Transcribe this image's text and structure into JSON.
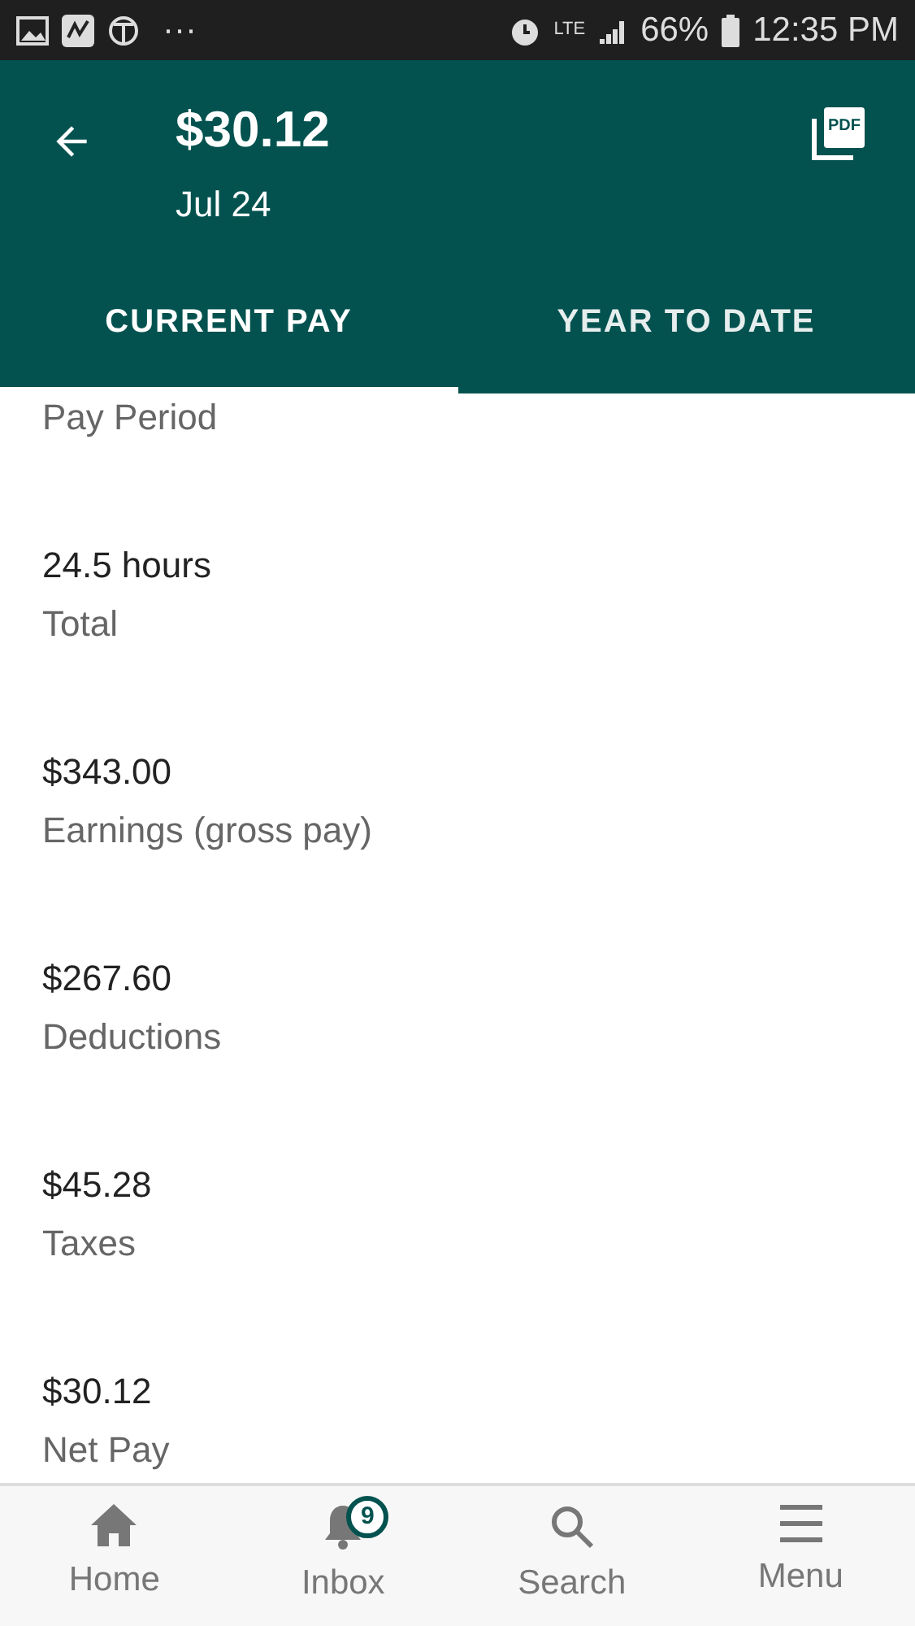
{
  "status_bar": {
    "more": "···",
    "network": "LTE",
    "battery": "66%",
    "time": "12:35 PM"
  },
  "header": {
    "amount": "$30.12",
    "date": "Jul 24",
    "pdf_label": "PDF"
  },
  "tabs": [
    {
      "label": "CURRENT PAY",
      "selected": true
    },
    {
      "label": "YEAR TO DATE",
      "selected": false
    }
  ],
  "items": [
    {
      "label": "Pay Period"
    },
    {
      "value": "24.5 hours",
      "label": "Total"
    },
    {
      "value": "$343.00",
      "label": "Earnings (gross pay)"
    },
    {
      "value": "$267.60",
      "label": "Deductions"
    },
    {
      "value": "$45.28",
      "label": "Taxes"
    },
    {
      "value": "$30.12",
      "label": "Net Pay"
    }
  ],
  "bottom_nav": [
    {
      "kind": "home",
      "label": "Home"
    },
    {
      "kind": "inbox",
      "label": "Inbox",
      "badge": "9"
    },
    {
      "kind": "search",
      "label": "Search"
    },
    {
      "kind": "menu",
      "label": "Menu"
    }
  ]
}
